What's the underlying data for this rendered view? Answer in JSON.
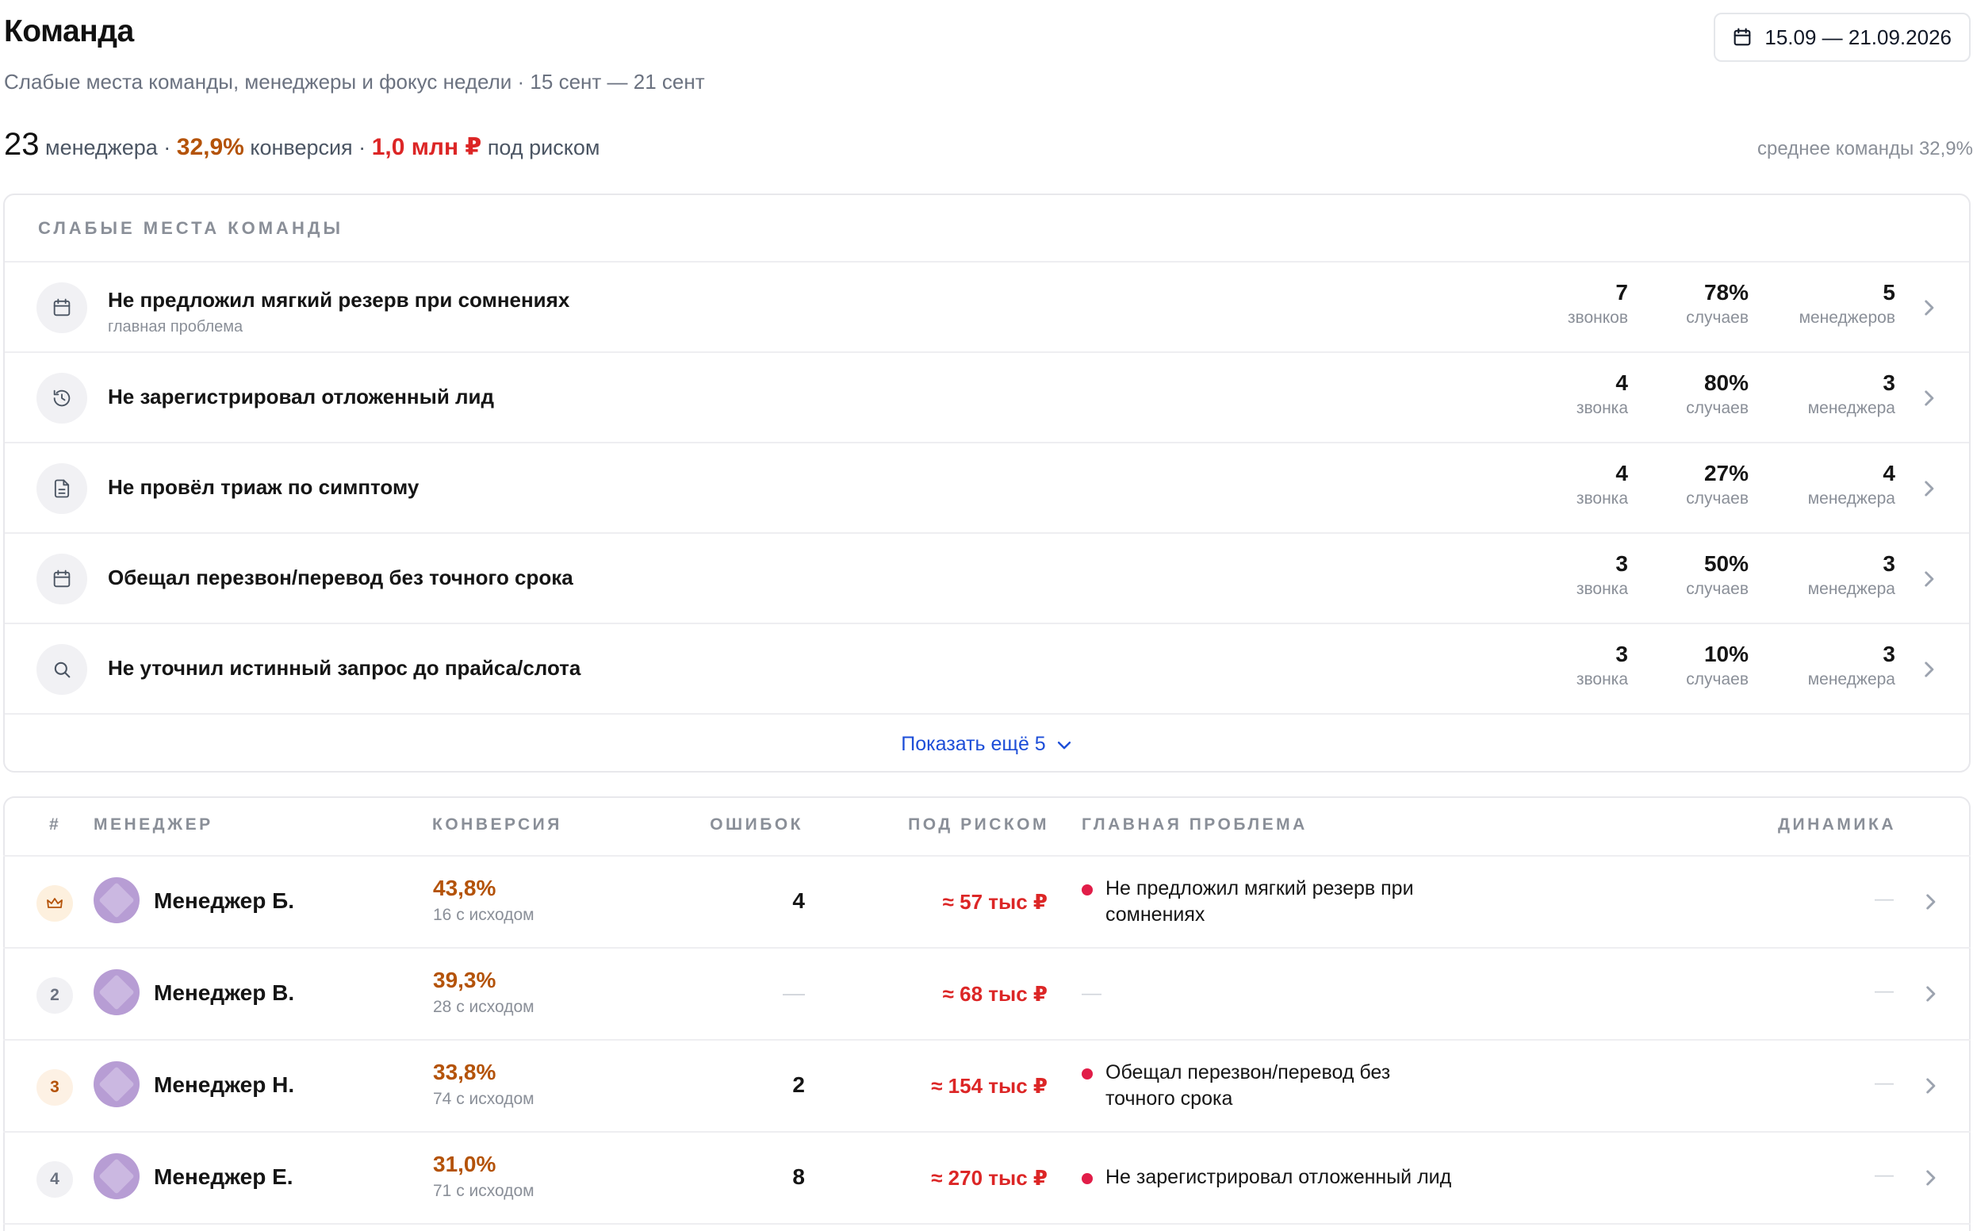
{
  "header": {
    "title": "Команда",
    "subtitle": "Слабые места команды, менеджеры и фокус недели · 15 сент — 21 сент",
    "date_range": "15.09 — 21.09.2026"
  },
  "summary": {
    "managers_count": "23",
    "managers_label": " менеджера · ",
    "conversion": "32,9%",
    "conversion_label": " конверсия · ",
    "at_risk": "1,0 млн ₽",
    "at_risk_label": " под риском",
    "team_average": "среднее команды 32,9%"
  },
  "weak_spots": {
    "heading": "СЛАБЫЕ МЕСТА КОМАНДЫ",
    "show_more": "Показать ещё 5",
    "items": [
      {
        "icon": "calendar-icon",
        "title": "Не предложил мягкий резерв при сомнениях",
        "subtitle": "главная проблема",
        "calls": "7",
        "calls_label": "звонков",
        "cases": "78%",
        "cases_label": "случаев",
        "managers": "5",
        "managers_label": "менеджеров"
      },
      {
        "icon": "history-icon",
        "title": "Не зарегистрировал отложенный лид",
        "subtitle": "",
        "calls": "4",
        "calls_label": "звонка",
        "cases": "80%",
        "cases_label": "случаев",
        "managers": "3",
        "managers_label": "менеджера"
      },
      {
        "icon": "document-icon",
        "title": "Не провёл триаж по симптому",
        "subtitle": "",
        "calls": "4",
        "calls_label": "звонка",
        "cases": "27%",
        "cases_label": "случаев",
        "managers": "4",
        "managers_label": "менеджера"
      },
      {
        "icon": "calendar-icon",
        "title": "Обещал перезвон/перевод без точного срока",
        "subtitle": "",
        "calls": "3",
        "calls_label": "звонка",
        "cases": "50%",
        "cases_label": "случаев",
        "managers": "3",
        "managers_label": "менеджера"
      },
      {
        "icon": "search-icon",
        "title": "Не уточнил истинный запрос до прайса/слота",
        "subtitle": "",
        "calls": "3",
        "calls_label": "звонка",
        "cases": "10%",
        "cases_label": "случаев",
        "managers": "3",
        "managers_label": "менеджера"
      }
    ]
  },
  "managers_table": {
    "columns": {
      "rank": "#",
      "manager": "МЕНЕДЖЕР",
      "conversion": "КОНВЕРСИЯ",
      "errors": "ОШИБОК",
      "at_risk": "ПОД РИСКОМ",
      "main_problem": "ГЛАВНАЯ ПРОБЛЕМА",
      "dynamics": "ДИНАМИКА"
    },
    "rows": [
      {
        "rank": "",
        "rank_icon": "crown-icon",
        "name": "Менеджер Б.",
        "conversion": "43,8%",
        "outcomes": "16 с исходом",
        "errors": "4",
        "at_risk": "≈ 57 тыс ₽",
        "problem": "Не предложил мягкий резерв при сомнениях",
        "dynamics": "—"
      },
      {
        "rank": "2",
        "name": "Менеджер В.",
        "conversion": "39,3%",
        "outcomes": "28 с исходом",
        "errors": "—",
        "at_risk": "≈ 68 тыс ₽",
        "problem": "—",
        "dynamics": "—"
      },
      {
        "rank": "3",
        "name": "Менеджер Н.",
        "conversion": "33,8%",
        "outcomes": "74 с исходом",
        "errors": "2",
        "at_risk": "≈ 154 тыс ₽",
        "problem": "Обещал перезвон/перевод без точного срока",
        "dynamics": "—"
      },
      {
        "rank": "4",
        "name": "Менеджер Е.",
        "conversion": "31,0%",
        "outcomes": "71 с исходом",
        "errors": "8",
        "at_risk": "≈ 270 тыс ₽",
        "problem": "Не зарегистрировал отложенный лид",
        "dynamics": "—"
      }
    ]
  },
  "colors": {
    "accent_orange": "#b45309",
    "risk_red": "#dc2626",
    "link_blue": "#1d4ed8",
    "problem_dot": "#e11d48"
  }
}
